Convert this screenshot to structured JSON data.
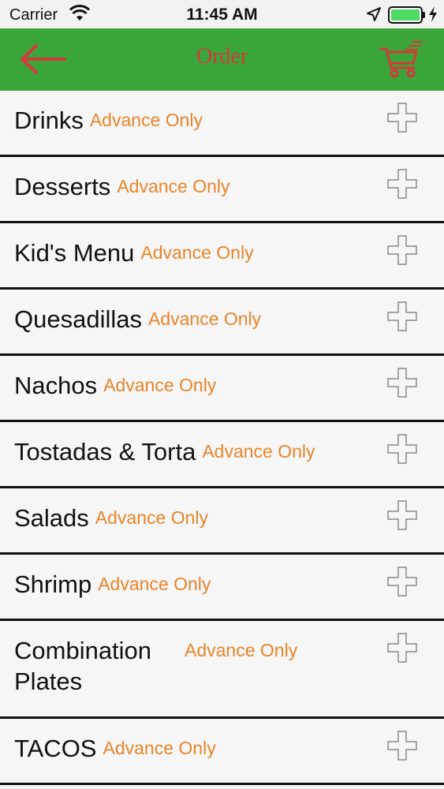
{
  "status_bar": {
    "carrier": "Carrier",
    "time": "11:45 AM",
    "battery_color": "#4cd964"
  },
  "nav": {
    "title": "Order",
    "back_icon": "back-arrow-icon",
    "cart_icon": "shopping-cart-icon",
    "bar_color": "#3aa63a",
    "accent_color": "#d33a3a"
  },
  "menu": {
    "tag_color": "#e8852a",
    "expand_icon": "plus-icon",
    "categories": [
      {
        "name": "Drinks",
        "tag": "Advance Only"
      },
      {
        "name": "Desserts",
        "tag": "Advance Only"
      },
      {
        "name": "Kid's Menu",
        "tag": "Advance Only"
      },
      {
        "name": "Quesadillas",
        "tag": "Advance Only"
      },
      {
        "name": "Nachos",
        "tag": "Advance Only"
      },
      {
        "name": "Tostadas & Torta",
        "tag": "Advance Only"
      },
      {
        "name": "Salads",
        "tag": "Advance Only"
      },
      {
        "name": "Shrimp",
        "tag": "Advance Only"
      },
      {
        "name": "Combination Plates",
        "tag": "Advance Only"
      },
      {
        "name": "TACOS",
        "tag": "Advance Only"
      }
    ]
  }
}
